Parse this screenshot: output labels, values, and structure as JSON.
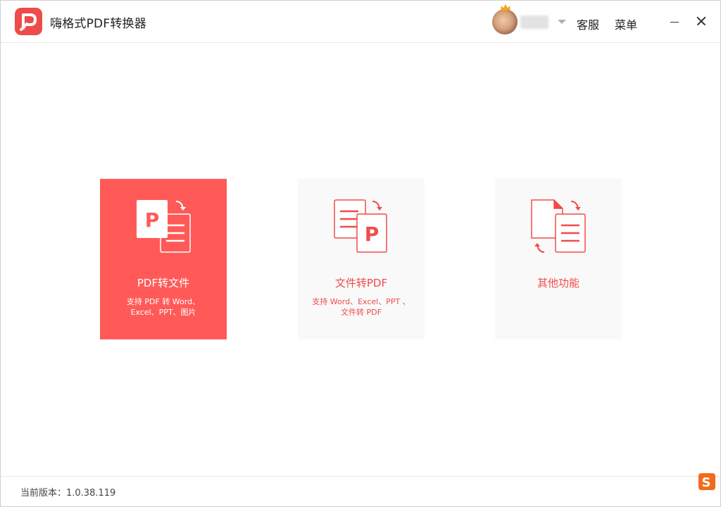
{
  "app": {
    "title": "嗨格式PDF转换器",
    "logo_icon": "pdf-p-logo-icon",
    "brand_color": "#ee4b4a"
  },
  "header": {
    "avatar_icon": "user-avatar",
    "crown_icon": "vip-crown-icon",
    "username": "",
    "service_label": "客服",
    "menu_label": "菜单",
    "minimize_icon": "minimize-icon",
    "close_icon": "close-icon"
  },
  "cards": [
    {
      "title": "PDF转文件",
      "desc_line1": "支持 PDF 转 Word、",
      "desc_line2": "Excel、PPT、图片",
      "icon": "pdf-to-file-icon",
      "active": true
    },
    {
      "title": "文件转PDF",
      "desc_line1": "支持 Word、Excel、PPT 、",
      "desc_line2": "文件转 PDF",
      "icon": "file-to-pdf-icon",
      "active": false
    },
    {
      "title": "其他功能",
      "desc_line1": "",
      "desc_line2": "",
      "icon": "other-functions-icon",
      "active": false
    }
  ],
  "footer": {
    "version": "当前版本：1.0.38.119"
  },
  "colors": {
    "accent": "#ff5a58",
    "accent_text": "#f04c4a",
    "card_bg": "#f9f9f9"
  }
}
